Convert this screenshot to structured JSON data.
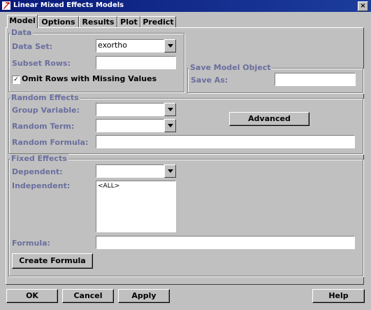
{
  "window": {
    "title": "Linear Mixed Effects Models",
    "close_glyph": "×"
  },
  "tabs": [
    {
      "label": "Model",
      "active": true
    },
    {
      "label": "Options"
    },
    {
      "label": "Results"
    },
    {
      "label": "Plot"
    },
    {
      "label": "Predict"
    }
  ],
  "data_group": {
    "title": "Data",
    "data_set_label": "Data Set:",
    "data_set_value": "exortho",
    "subset_rows_label": "Subset Rows:",
    "subset_rows_value": "",
    "omit_rows_label": "Omit Rows with Missing Values",
    "omit_rows_checked": true,
    "check_glyph": "✓"
  },
  "save_group": {
    "title": "Save Model Object",
    "save_as_label": "Save As:",
    "save_as_value": ""
  },
  "random_group": {
    "title": "Random Effects",
    "group_variable_label": "Group Variable:",
    "group_variable_value": "",
    "random_term_label": "Random Term:",
    "random_term_value": "",
    "random_formula_label": "Random Formula:",
    "random_formula_value": "",
    "advanced_button": "Advanced"
  },
  "fixed_group": {
    "title": "Fixed Effects",
    "dependent_label": "Dependent:",
    "dependent_value": "",
    "independent_label": "Independent:",
    "independent_items": [
      "<ALL>"
    ],
    "formula_label": "Formula:",
    "formula_value": "",
    "create_formula_button": "Create Formula"
  },
  "buttons": {
    "ok": "OK",
    "cancel": "Cancel",
    "apply": "Apply",
    "help": "Help"
  },
  "colors": {
    "title_bar": "#0a1a7a",
    "label": "#6a6f9e",
    "background": "#c0c0c0",
    "app_icon": "#cc1111"
  }
}
